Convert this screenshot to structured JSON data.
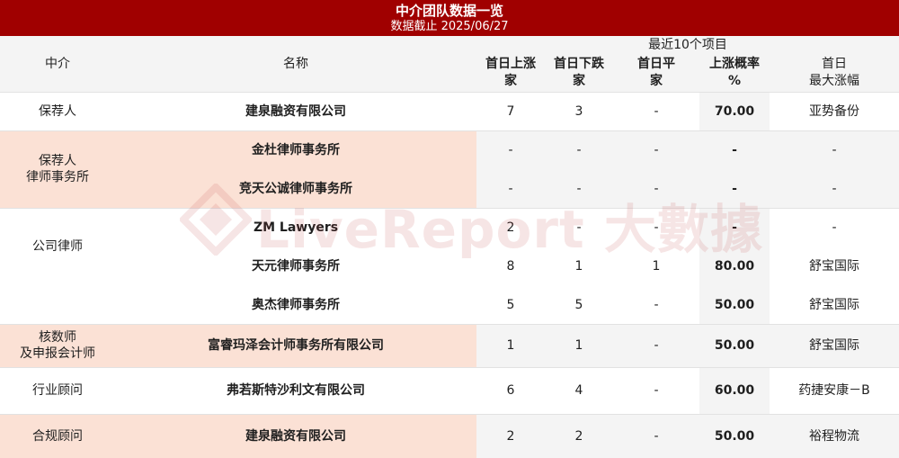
{
  "banner": {
    "title": "中介团队数据一览",
    "subtitle": "数据截止 2025/06/27"
  },
  "header": {
    "col_agent": "中介",
    "col_name": "名称",
    "group": "最近10个项目",
    "up": "首日上涨\n家",
    "down": "首日下跌\n家",
    "flat": "首日平\n家",
    "rate": "上涨概率\n%",
    "max": "首日\n最大涨幅"
  },
  "groups": {
    "g1": "保荐人",
    "g2": "保荐人\n律师事务所",
    "g3": "公司律师",
    "g4": "核数师\n及申报会计师",
    "g5": "行业顾问",
    "g6": "合规顾问"
  },
  "rows": [
    {
      "name": "建泉融资有限公司",
      "up": "7",
      "down": "3",
      "flat": "-",
      "rate": "70.00",
      "max": "亚势备份"
    },
    {
      "name": "金杜律师事务所",
      "up": "-",
      "down": "-",
      "flat": "-",
      "rate": "-",
      "max": "-"
    },
    {
      "name": "竞天公诚律师事务所",
      "up": "-",
      "down": "-",
      "flat": "-",
      "rate": "-",
      "max": "-"
    },
    {
      "name": "ZM Lawyers",
      "up": "2",
      "down": "-",
      "flat": "-",
      "rate": "-",
      "max": "-"
    },
    {
      "name": "天元律师事务所",
      "up": "8",
      "down": "1",
      "flat": "1",
      "rate": "80.00",
      "max": "舒宝国际"
    },
    {
      "name": "奥杰律师事务所",
      "up": "5",
      "down": "5",
      "flat": "-",
      "rate": "50.00",
      "max": "舒宝国际"
    },
    {
      "name": "富睿玛泽会计师事务所有限公司",
      "up": "1",
      "down": "1",
      "flat": "-",
      "rate": "50.00",
      "max": "舒宝国际"
    },
    {
      "name": "弗若斯特沙利文有限公司",
      "up": "6",
      "down": "4",
      "flat": "-",
      "rate": "60.00",
      "max": "药捷安康－B"
    },
    {
      "name": "建泉融资有限公司",
      "up": "2",
      "down": "2",
      "flat": "-",
      "rate": "50.00",
      "max": "裕程物流"
    }
  ],
  "watermark": "LiveReport 大數據",
  "colors": {
    "banner": "#a00000",
    "peach": "#fbe1d5",
    "header_bg": "#f4f4f4"
  }
}
